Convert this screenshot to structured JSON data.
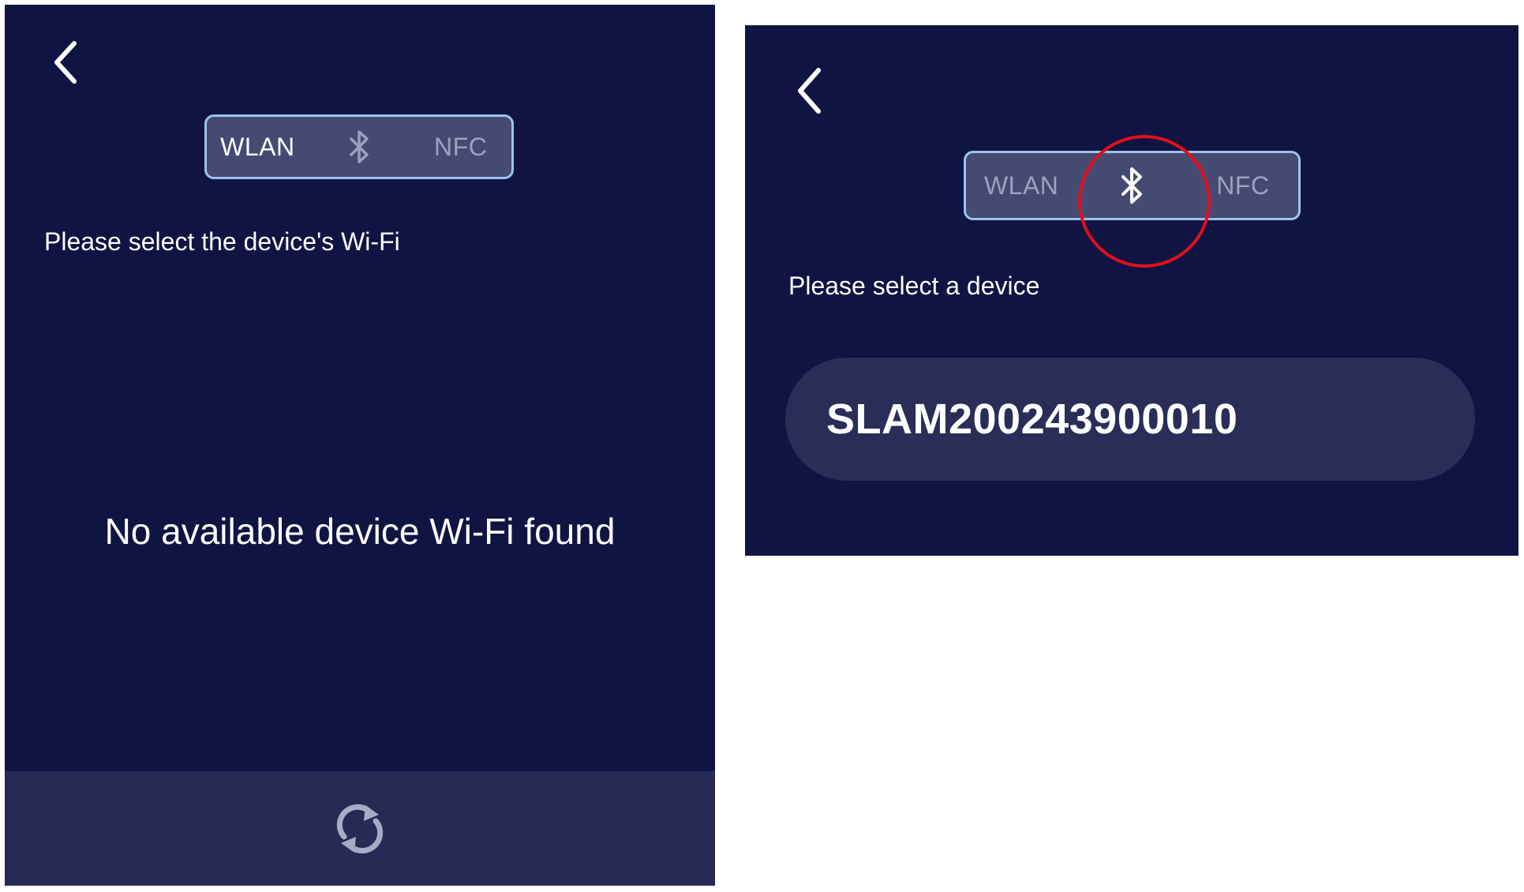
{
  "colors": {
    "background": "#101442",
    "segment_bg": "#444a72",
    "segment_border": "#9bc4f0",
    "bottom_bar": "#262a54",
    "device_item_bg": "#2a2d58",
    "highlight": "#e0101c"
  },
  "left_screen": {
    "back_icon": "chevron-left-icon",
    "tabs": [
      {
        "label": "WLAN",
        "state": "selected"
      },
      {
        "label": "",
        "icon": "bluetooth-icon",
        "state": "unselected"
      },
      {
        "label": "NFC",
        "state": "unselected"
      }
    ],
    "prompt": "Please select the device's Wi-Fi",
    "empty_message": "No available device Wi-Fi found",
    "refresh_icon": "refresh-icon"
  },
  "right_screen": {
    "back_icon": "chevron-left-icon",
    "tabs": [
      {
        "label": "WLAN",
        "state": "unselected"
      },
      {
        "label": "",
        "icon": "bluetooth-icon",
        "state": "selected"
      },
      {
        "label": "NFC",
        "state": "unselected"
      }
    ],
    "prompt": "Please select a device",
    "devices": [
      {
        "name": "SLAM200243900010"
      }
    ],
    "annotation": "red-circle-highlight"
  }
}
